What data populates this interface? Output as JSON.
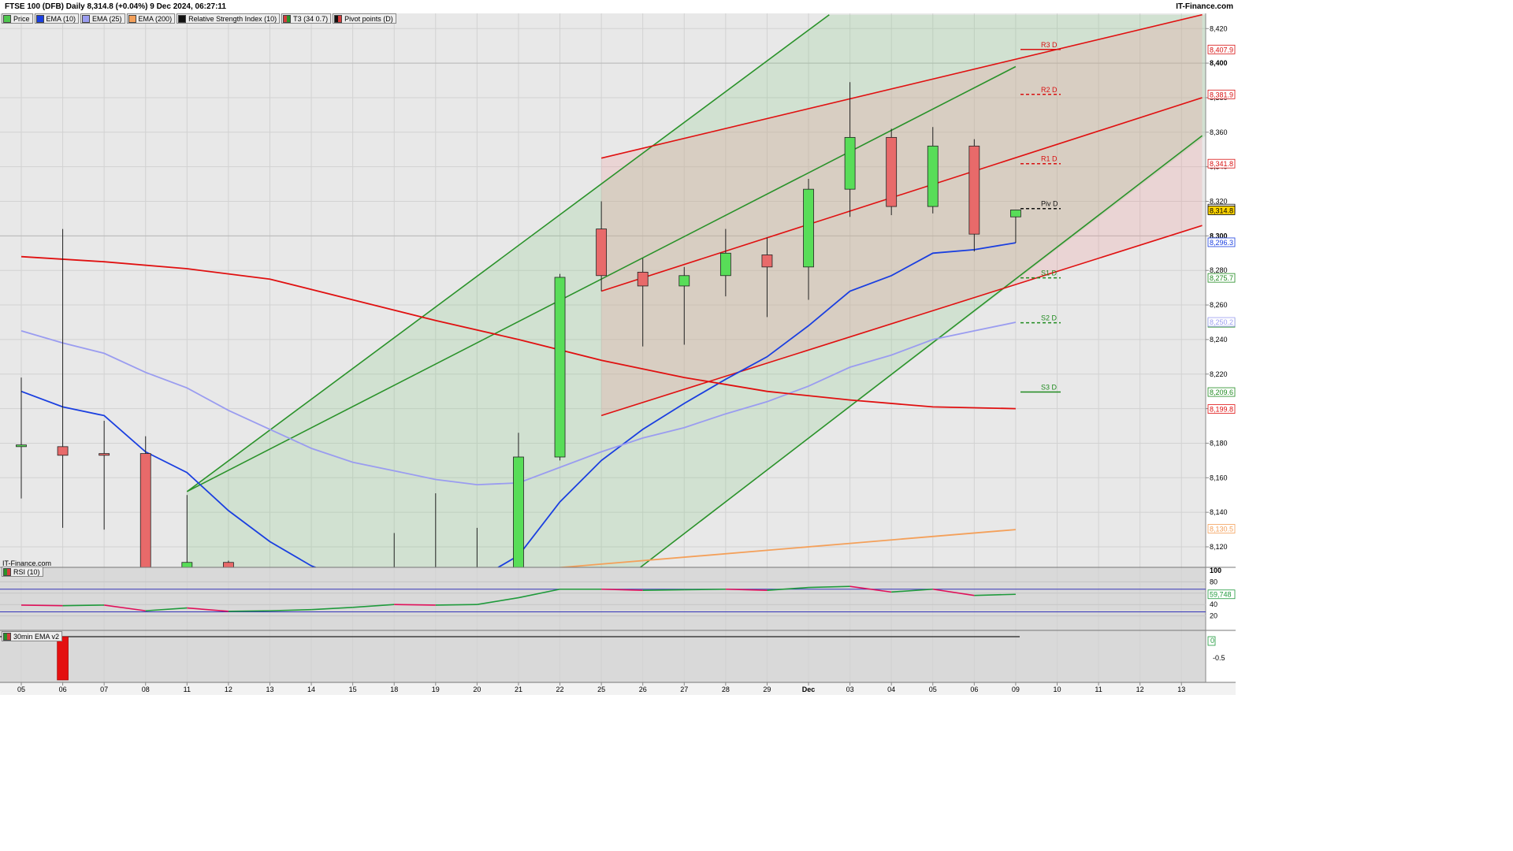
{
  "header": {
    "title": "FTSE 100 (DFB) Daily 8,314.8 (+0.04%) 9 Dec 2024, 06:27:11",
    "brand": "IT-Finance.com"
  },
  "legend": [
    {
      "label": "Price",
      "color": "#4fc84f"
    },
    {
      "label": "EMA (10)",
      "color": "#1a3fe0"
    },
    {
      "label": "EMA (25)",
      "color": "#9a9cf0"
    },
    {
      "label": "EMA (200)",
      "color": "#f4a05a"
    },
    {
      "label": "Relative Strength Index (10)",
      "color": "#111111"
    },
    {
      "label": "T3 (34 0.7)",
      "color": "#d43c3c"
    },
    {
      "label": "Pivot points (D)",
      "color": "#111111"
    }
  ],
  "watermark": "IT-Finance.com",
  "rsi_panel": {
    "label": "RSI (10)",
    "ticks": [
      "100",
      "80",
      "60",
      "40",
      "20"
    ],
    "value_tag": "59,748"
  },
  "ema_panel": {
    "label": "30min EMA v2",
    "ticks": [
      "0",
      "-0.5"
    ],
    "value_tag": "0"
  },
  "chart_data": {
    "type": "candlestick",
    "title": "FTSE 100 (DFB) Daily",
    "x_labels": [
      "05",
      "06",
      "07",
      "08",
      "11",
      "12",
      "13",
      "14",
      "15",
      "18",
      "19",
      "20",
      "21",
      "22",
      "25",
      "26",
      "27",
      "28",
      "29",
      "Dec",
      "03",
      "04",
      "05",
      "06",
      "09",
      "10",
      "11",
      "12",
      "13"
    ],
    "y_ticks": [
      8120,
      8140,
      8160,
      8180,
      8200,
      8220,
      8240,
      8260,
      8280,
      8300,
      8320,
      8340,
      8360,
      8380,
      8400,
      8420
    ],
    "y_tick_labels": [
      "8,120",
      "8,140",
      "8,160",
      "8,180",
      "8,200",
      "8,220",
      "8,240",
      "8,260",
      "8,280",
      "8,300",
      "8,320",
      "8,340",
      "8,360",
      "8,380",
      "8,400",
      "8,420"
    ],
    "ylim": [
      8108,
      8426
    ],
    "candles": [
      {
        "i": 0,
        "o": 8178,
        "h": 8218,
        "l": 8148,
        "c": 8179
      },
      {
        "i": 1,
        "o": 8178,
        "h": 8304,
        "l": 8131,
        "c": 8173
      },
      {
        "i": 2,
        "o": 8174,
        "h": 8193,
        "l": 8130,
        "c": 8173
      },
      {
        "i": 3,
        "o": 8174,
        "h": 8184,
        "l": 8106,
        "c": 8106
      },
      {
        "i": 4,
        "o": 8108,
        "h": 8150,
        "l": 8106,
        "c": 8111
      },
      {
        "i": 5,
        "o": 8111,
        "h": 8112,
        "l": 8106,
        "c": 8108
      },
      {
        "i": 9,
        "o": 8108,
        "h": 8128,
        "l": 8106,
        "c": 8108
      },
      {
        "i": 10,
        "o": 8108,
        "h": 8151,
        "l": 8106,
        "c": 8108
      },
      {
        "i": 11,
        "o": 8108,
        "h": 8131,
        "l": 8106,
        "c": 8108
      },
      {
        "i": 12,
        "o": 8108,
        "h": 8186,
        "l": 8106,
        "c": 8172
      },
      {
        "i": 13,
        "o": 8172,
        "h": 8278,
        "l": 8170,
        "c": 8276
      },
      {
        "i": 14,
        "o": 8304,
        "h": 8320,
        "l": 8268,
        "c": 8277
      },
      {
        "i": 15,
        "o": 8279,
        "h": 8287,
        "l": 8236,
        "c": 8271
      },
      {
        "i": 16,
        "o": 8271,
        "h": 8282,
        "l": 8237,
        "c": 8277
      },
      {
        "i": 17,
        "o": 8277,
        "h": 8304,
        "l": 8265,
        "c": 8290
      },
      {
        "i": 18,
        "o": 8289,
        "h": 8299,
        "l": 8253,
        "c": 8282
      },
      {
        "i": 19,
        "o": 8282,
        "h": 8333,
        "l": 8263,
        "c": 8327
      },
      {
        "i": 20,
        "o": 8327,
        "h": 8389,
        "l": 8311,
        "c": 8357
      },
      {
        "i": 21,
        "o": 8357,
        "h": 8362,
        "l": 8312,
        "c": 8317
      },
      {
        "i": 22,
        "o": 8317,
        "h": 8363,
        "l": 8313,
        "c": 8352
      },
      {
        "i": 23,
        "o": 8352,
        "h": 8356,
        "l": 8291,
        "c": 8301
      },
      {
        "i": 24,
        "o": 8311,
        "h": 8315,
        "l": 8296,
        "c": 8315
      }
    ],
    "series": [
      {
        "name": "EMA (10)",
        "color": "#1a3fe0",
        "points": [
          [
            0,
            8210
          ],
          [
            1,
            8201
          ],
          [
            2,
            8196
          ],
          [
            3,
            8175
          ],
          [
            4,
            8163
          ],
          [
            5,
            8141
          ],
          [
            6,
            8123
          ],
          [
            7,
            8109
          ],
          [
            8,
            8100
          ],
          [
            9,
            8097
          ],
          [
            10,
            8098
          ],
          [
            11,
            8101
          ],
          [
            12,
            8115
          ],
          [
            13,
            8146
          ],
          [
            14,
            8170
          ],
          [
            15,
            8188
          ],
          [
            16,
            8203
          ],
          [
            17,
            8217
          ],
          [
            18,
            8230
          ],
          [
            19,
            8248
          ],
          [
            20,
            8268
          ],
          [
            21,
            8277
          ],
          [
            22,
            8290
          ],
          [
            23,
            8292
          ],
          [
            24,
            8296
          ]
        ]
      },
      {
        "name": "EMA (25)",
        "color": "#9a9cf0",
        "points": [
          [
            0,
            8245
          ],
          [
            1,
            8238
          ],
          [
            2,
            8232
          ],
          [
            3,
            8221
          ],
          [
            4,
            8212
          ],
          [
            5,
            8199
          ],
          [
            6,
            8188
          ],
          [
            7,
            8177
          ],
          [
            8,
            8169
          ],
          [
            9,
            8164
          ],
          [
            10,
            8159
          ],
          [
            11,
            8156
          ],
          [
            12,
            8157
          ],
          [
            13,
            8166
          ],
          [
            14,
            8175
          ],
          [
            15,
            8183
          ],
          [
            16,
            8189
          ],
          [
            17,
            8197
          ],
          [
            18,
            8204
          ],
          [
            19,
            8213
          ],
          [
            20,
            8224
          ],
          [
            21,
            8231
          ],
          [
            22,
            8240
          ],
          [
            23,
            8245
          ],
          [
            24,
            8250
          ]
        ]
      },
      {
        "name": "EMA (200)",
        "color": "#f4a05a",
        "points": [
          [
            0,
            8106
          ],
          [
            2,
            8107
          ],
          [
            4,
            8107
          ],
          [
            8,
            8106
          ],
          [
            12,
            8106
          ],
          [
            14,
            8110
          ],
          [
            18,
            8118
          ],
          [
            20,
            8122
          ],
          [
            22,
            8126
          ],
          [
            24,
            8130
          ]
        ]
      },
      {
        "name": "T3 (34 0.7)",
        "color": "#e01010",
        "points": [
          [
            0,
            8288
          ],
          [
            2,
            8285
          ],
          [
            4,
            8281
          ],
          [
            6,
            8275
          ],
          [
            8,
            8263
          ],
          [
            10,
            8251
          ],
          [
            12,
            8240
          ],
          [
            14,
            8228
          ],
          [
            16,
            8218
          ],
          [
            18,
            8210
          ],
          [
            20,
            8205
          ],
          [
            22,
            8201
          ],
          [
            24,
            8200
          ]
        ]
      }
    ],
    "channels": [
      {
        "kind": "green",
        "color": "#2a922a",
        "upper": [
          [
            4,
            8152
          ],
          [
            19.5,
            8428
          ]
        ],
        "lower": [
          [
            14.5,
            8100
          ],
          [
            28.5,
            8358
          ]
        ],
        "fill": "rgba(140,205,140,0.25)"
      },
      {
        "kind": "red",
        "color": "#e01010",
        "upper": [
          [
            14,
            8345
          ],
          [
            28.5,
            8428
          ]
        ],
        "lower": [
          [
            14,
            8196
          ],
          [
            28.5,
            8306
          ]
        ],
        "mid": [
          [
            14,
            8268
          ],
          [
            28.5,
            8380
          ]
        ],
        "fill": "rgba(240,150,150,0.25)"
      }
    ],
    "pivots": [
      {
        "label": "R3 D",
        "value": 8407.9,
        "tag": "8,407.9",
        "color": "#d81010",
        "dashed": false
      },
      {
        "label": "R2 D",
        "value": 8381.9,
        "tag": "8,381.9",
        "color": "#d81010",
        "dashed": true
      },
      {
        "label": "R1 D",
        "value": 8341.8,
        "tag": "8,341.8",
        "color": "#d81010",
        "dashed": true
      },
      {
        "label": "Piv D",
        "value": 8315.8,
        "tag": "8,315.8",
        "color": "#111111",
        "dashed": true
      },
      {
        "label": "S1 D",
        "value": 8275.7,
        "tag": "8,275.7",
        "color": "#1f8a1f",
        "dashed": true
      },
      {
        "label": "S2 D",
        "value": 8249.7,
        "tag": "8,249.7",
        "color": "#1f8a1f",
        "dashed": true
      },
      {
        "label": "S3 D",
        "value": 8209.6,
        "tag": "8,209.6",
        "color": "#1f8a1f",
        "dashed": false
      }
    ],
    "price_tags": [
      {
        "value": 8314.8,
        "tag": "8,314.8",
        "bg": "#ffd400",
        "fg": "#000000"
      },
      {
        "value": 8296.3,
        "tag": "8,296.3",
        "bg": "#ffffff",
        "fg": "#1a3fe0"
      },
      {
        "value": 8250.2,
        "tag": "8,250.2",
        "bg": "#ffffff",
        "fg": "#9a9cf0"
      },
      {
        "value": 8199.8,
        "tag": "8,199.8",
        "bg": "#ffffff",
        "fg": "#e01010"
      },
      {
        "value": 8130.5,
        "tag": "8,130.5",
        "bg": "#ffffff",
        "fg": "#f4a05a"
      }
    ],
    "rsi": {
      "range": [
        0,
        100
      ],
      "upper_band": 67,
      "lower_band": 27,
      "values": [
        [
          0,
          39
        ],
        [
          1,
          38
        ],
        [
          2,
          39
        ],
        [
          3,
          29
        ],
        [
          4,
          34
        ],
        [
          5,
          28
        ],
        [
          6,
          29
        ],
        [
          7,
          31
        ],
        [
          8,
          35
        ],
        [
          9,
          40
        ],
        [
          10,
          39
        ],
        [
          11,
          40
        ],
        [
          12,
          52
        ],
        [
          13,
          67
        ],
        [
          14,
          67
        ],
        [
          15,
          65
        ],
        [
          16,
          66
        ],
        [
          17,
          67
        ],
        [
          18,
          65
        ],
        [
          19,
          70
        ],
        [
          20,
          72
        ],
        [
          21,
          62
        ],
        [
          22,
          67
        ],
        [
          23,
          56
        ],
        [
          24,
          58
        ]
      ]
    },
    "ema_osc": {
      "values": [
        [
          1,
          -0.55
        ]
      ]
    }
  }
}
